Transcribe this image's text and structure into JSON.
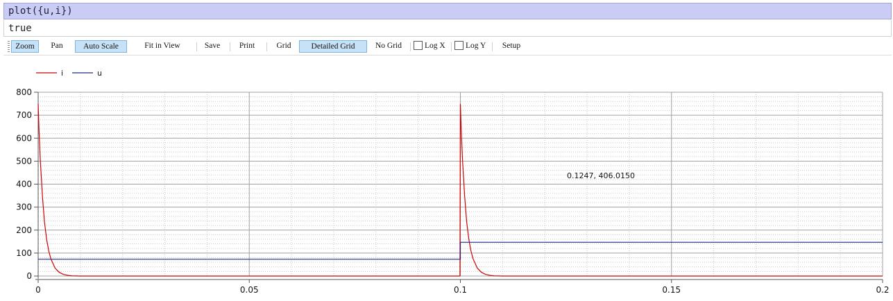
{
  "command": "plot({u,i})",
  "result": "true",
  "toolbar": {
    "zoom": "Zoom",
    "pan": "Pan",
    "auto_scale": "Auto Scale",
    "fit_in_view": "Fit in View",
    "save": "Save",
    "print": "Print",
    "grid": "Grid",
    "detailed_grid": "Detailed Grid",
    "no_grid": "No Grid",
    "log_x": "Log X",
    "log_y": "Log Y",
    "setup": "Setup",
    "active": [
      "Zoom",
      "Auto Scale",
      "Detailed Grid"
    ],
    "log_x_checked": false,
    "log_y_checked": false
  },
  "cursor_readout": "0.1247, 406.0150",
  "chart_data": {
    "type": "line",
    "title": "",
    "xlabel": "",
    "ylabel": "",
    "xlim": [
      0,
      0.2
    ],
    "ylim": [
      0,
      800
    ],
    "x_ticks": [
      0,
      0.05,
      0.1,
      0.15,
      0.2
    ],
    "x_tick_labels": [
      "0",
      "0.05",
      "0.1",
      "0.15",
      "0.2"
    ],
    "y_ticks": [
      0,
      100,
      200,
      300,
      400,
      500,
      600,
      700,
      800
    ],
    "y_tick_labels": [
      "0",
      "100",
      "200",
      "300",
      "400",
      "500",
      "600",
      "700",
      "800"
    ],
    "grid": "detailed",
    "legend_position": "top-left",
    "series": [
      {
        "name": "i",
        "color": "#cc0000",
        "x": [
          0,
          0.0002,
          0.0005,
          0.001,
          0.0015,
          0.002,
          0.0025,
          0.003,
          0.004,
          0.005,
          0.006,
          0.007,
          0.008,
          0.01,
          0.0999,
          0.1,
          0.1002,
          0.1005,
          0.101,
          0.1015,
          0.102,
          0.1025,
          0.103,
          0.104,
          0.105,
          0.106,
          0.107,
          0.108,
          0.11,
          0.2
        ],
        "values": [
          750,
          640,
          510,
          350,
          235,
          160,
          110,
          75,
          35,
          16,
          7,
          3,
          1,
          0,
          0,
          750,
          640,
          510,
          350,
          235,
          160,
          110,
          75,
          35,
          16,
          7,
          3,
          1,
          0,
          0
        ]
      },
      {
        "name": "u",
        "color": "#1a2a8c",
        "x": [
          0,
          0.1,
          0.1,
          0.2
        ],
        "values": [
          73,
          73,
          147,
          147
        ]
      }
    ]
  }
}
